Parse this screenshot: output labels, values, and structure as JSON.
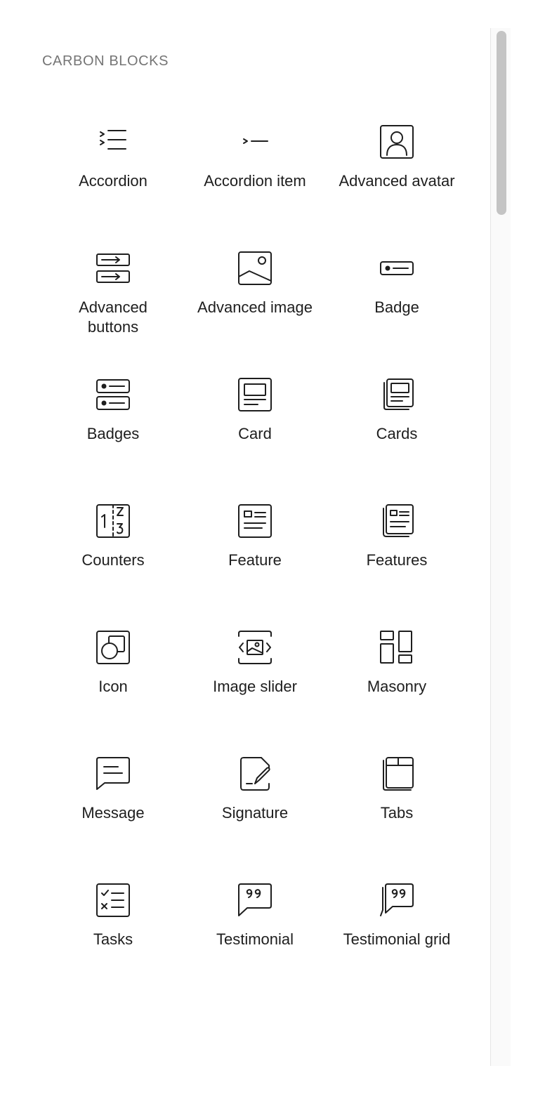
{
  "section": {
    "title": "CARBON BLOCKS"
  },
  "blocks": [
    {
      "label": "Accordion",
      "icon": "accordion-icon"
    },
    {
      "label": "Accordion item",
      "icon": "accordion-item-icon"
    },
    {
      "label": "Advanced avatar",
      "icon": "avatar-icon"
    },
    {
      "label": "Advanced buttons",
      "icon": "buttons-icon"
    },
    {
      "label": "Advanced image",
      "icon": "image-icon"
    },
    {
      "label": "Badge",
      "icon": "badge-icon"
    },
    {
      "label": "Badges",
      "icon": "badges-icon"
    },
    {
      "label": "Card",
      "icon": "card-icon"
    },
    {
      "label": "Cards",
      "icon": "cards-icon"
    },
    {
      "label": "Counters",
      "icon": "counters-icon"
    },
    {
      "label": "Feature",
      "icon": "feature-icon"
    },
    {
      "label": "Features",
      "icon": "features-icon"
    },
    {
      "label": "Icon",
      "icon": "shapes-icon"
    },
    {
      "label": "Image slider",
      "icon": "image-slider-icon"
    },
    {
      "label": "Masonry",
      "icon": "masonry-icon"
    },
    {
      "label": "Message",
      "icon": "message-icon"
    },
    {
      "label": "Signature",
      "icon": "signature-icon"
    },
    {
      "label": "Tabs",
      "icon": "tabs-icon"
    },
    {
      "label": "Tasks",
      "icon": "tasks-icon"
    },
    {
      "label": "Testimonial",
      "icon": "testimonial-icon"
    },
    {
      "label": "Testimonial grid",
      "icon": "testimonial-grid-icon"
    }
  ]
}
